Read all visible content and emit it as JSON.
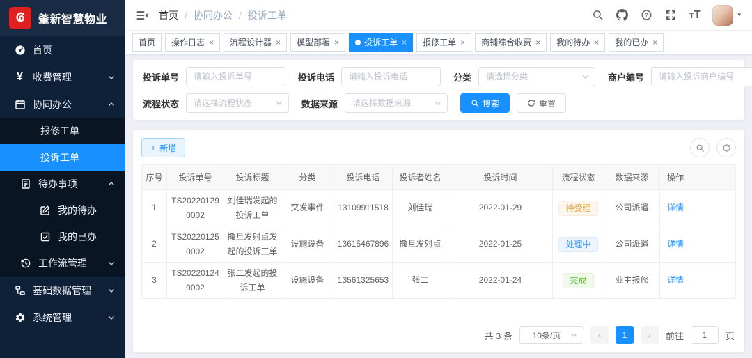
{
  "colors": {
    "primary": "#1890ff",
    "sidebar_bg": "#0e2139",
    "logo_bar_bg": "#1a2b45",
    "submenu_bg": "#091523",
    "logo_red": "#e0201e",
    "tag_warning_text": "#e6a23c",
    "tag_primary_text": "#409eff",
    "tag_success_text": "#67c23a",
    "content_bg": "#eef0f6"
  },
  "icons": {
    "plus": "+",
    "close": "×",
    "caret_down": "▾",
    "slash": "/",
    "prev": "‹",
    "next": "›",
    "font_small": "T",
    "font_large": "T",
    "question": "?"
  },
  "sidebar": {
    "logo_text": "肇新智慧物业",
    "items": {
      "home": "首页",
      "fee": "收费管理",
      "collab": "协同办公",
      "repair": "报修工单",
      "complaint": "投诉工单",
      "todo_matters": "待办事项",
      "my_todo": "我的待办",
      "my_done": "我的已办",
      "workflow": "工作流管理",
      "basic_data": "基础数据管理",
      "system": "系统管理"
    }
  },
  "breadcrumb": {
    "items": [
      "首页",
      "协同办公",
      "投诉工单"
    ]
  },
  "tabs": [
    {
      "label": "首页"
    },
    {
      "label": "操作日志"
    },
    {
      "label": "流程设计器"
    },
    {
      "label": "模型部署"
    },
    {
      "label": "投诉工单"
    },
    {
      "label": "报修工单"
    },
    {
      "label": "商铺综合收费"
    },
    {
      "label": "我的待办"
    },
    {
      "label": "我的已办"
    }
  ],
  "search_form": {
    "complaint_no": {
      "label": "投诉单号",
      "placeholder": "请输入投诉单号"
    },
    "phone": {
      "label": "投诉电话",
      "placeholder": "请输入投诉电话"
    },
    "category": {
      "label": "分类",
      "placeholder": "请选择分类"
    },
    "merchant_no": {
      "label": "商户编号",
      "placeholder": "请输入投诉商户编号"
    },
    "flow_status": {
      "label": "流程状态",
      "placeholder": "请选择流程状态"
    },
    "data_source": {
      "label": "数据来源",
      "placeholder": "请选择数据来源"
    },
    "search_label": "搜索",
    "reset_label": "重置"
  },
  "toolbar": {
    "add_label": "新增"
  },
  "table": {
    "columns": [
      "序号",
      "投诉单号",
      "投诉标题",
      "分类",
      "投诉电话",
      "投诉者姓名",
      "投诉时间",
      "流程状态",
      "数据来源",
      "操作"
    ],
    "rows": [
      {
        "index": "1",
        "no": "TS202201290002",
        "title": "刘佳瑞发起的投诉工单",
        "category": "突发事件",
        "phone": "13109911518",
        "name": "刘佳瑞",
        "time": "2022-01-29",
        "status": "待受理",
        "source": "公司派遣",
        "action": "详情"
      },
      {
        "index": "2",
        "no": "TS202201250002",
        "title": "撒旦发射点发起的投诉工单",
        "category": "设施设备",
        "phone": "13615467896",
        "name": "撒旦发射点",
        "time": "2022-01-25",
        "status": "处理中",
        "source": "公司派遣",
        "action": "详情"
      },
      {
        "index": "3",
        "no": "TS202201240002",
        "title": "张二发起的投诉工单",
        "category": "设施设备",
        "phone": "13561325653",
        "name": "张二",
        "time": "2022-01-24",
        "status": "完成",
        "source": "业主报修",
        "action": "详情"
      }
    ]
  },
  "pagination": {
    "total": "共 3 条",
    "page_size": "10条/页",
    "page": "1",
    "goto_label": "前往",
    "goto_value": "1",
    "unit": "页"
  }
}
